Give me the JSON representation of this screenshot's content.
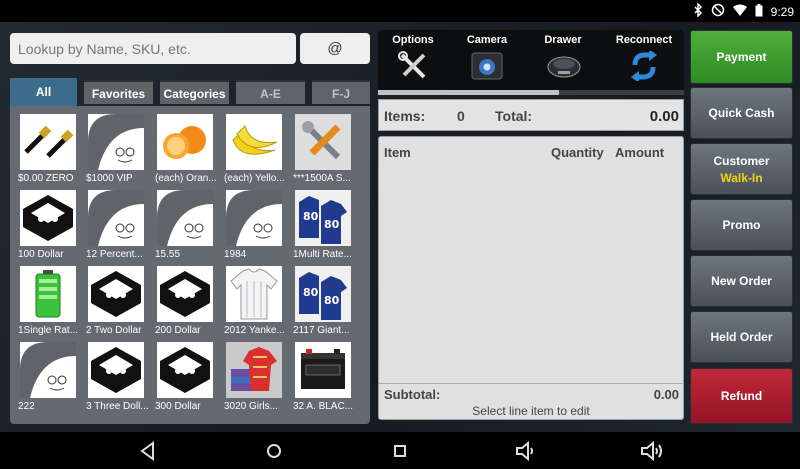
{
  "status": {
    "time": "9:29"
  },
  "search": {
    "placeholder": "Lookup by Name, SKU, etc.",
    "at_label": "@"
  },
  "tabs": [
    {
      "label": "All"
    },
    {
      "label": "Favorites"
    },
    {
      "label": "Categories"
    },
    {
      "label": "A-E"
    },
    {
      "label": "F-J"
    }
  ],
  "items": [
    {
      "label": "$0.00 ZERO",
      "icon": "cable-icon"
    },
    {
      "label": "$1000 VIP",
      "icon": "placeholder-face-icon"
    },
    {
      "label": "(each) Oran...",
      "icon": "orange-icon"
    },
    {
      "label": "(each) Yello...",
      "icon": "banana-icon"
    },
    {
      "label": "***1500A S...",
      "icon": "tools-icon"
    },
    {
      "label": "100 Dollar",
      "icon": "box-logo-icon"
    },
    {
      "label": "12 Percent...",
      "icon": "placeholder-face-icon"
    },
    {
      "label": "15.55",
      "icon": "placeholder-face-icon"
    },
    {
      "label": "1984",
      "icon": "placeholder-face-icon"
    },
    {
      "label": "1Multi Rate...",
      "icon": "jersey-icon"
    },
    {
      "label": "1Single Rat...",
      "icon": "battery-icon"
    },
    {
      "label": "2 Two Dollar",
      "icon": "box-logo-icon"
    },
    {
      "label": "200 Dollar",
      "icon": "box-logo-icon"
    },
    {
      "label": "2012 Yanke...",
      "icon": "shirt-icon"
    },
    {
      "label": "2117 Giant...",
      "icon": "jersey-icon"
    },
    {
      "label": "222",
      "icon": "placeholder-face-icon"
    },
    {
      "label": "3 Three Doll...",
      "icon": "box-logo-icon"
    },
    {
      "label": "300 Dollar",
      "icon": "box-logo-icon"
    },
    {
      "label": "3020 Girls...",
      "icon": "clothes-icon"
    },
    {
      "label": "32 A. BLAC...",
      "icon": "battery-box-icon"
    }
  ],
  "toolbar": {
    "options": "Options",
    "camera": "Camera",
    "drawer": "Drawer",
    "reconnect": "Reconnect"
  },
  "totals": {
    "items_label": "Items:",
    "items_value": "0",
    "total_label": "Total:",
    "total_value": "0.00"
  },
  "order": {
    "col_item": "Item",
    "col_quantity": "Quantity",
    "col_amount": "Amount",
    "subtotal_label": "Subtotal:",
    "subtotal_value": "0.00",
    "hint": "Select line item to edit"
  },
  "buttons": {
    "payment": "Payment",
    "quick_cash": "Quick Cash",
    "customer": "Customer",
    "customer_value": "Walk-In",
    "promo": "Promo",
    "new_order": "New Order",
    "held_order": "Held Order",
    "refund": "Refund"
  },
  "colors": {
    "payment": "#3a9b2d",
    "refund": "#b01f33",
    "walk_in": "#f2d21a",
    "active_tab": "#3d6b8c"
  }
}
